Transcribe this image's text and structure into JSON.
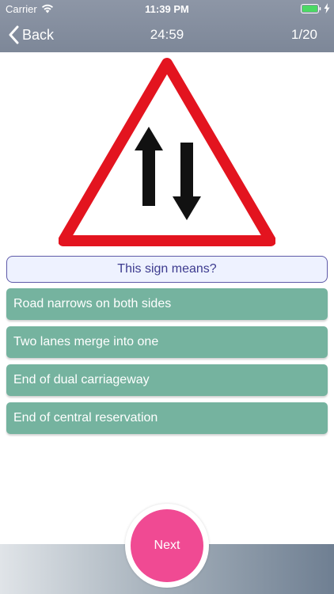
{
  "status_bar": {
    "carrier": "Carrier",
    "time": "11:39 PM",
    "icons": [
      "wifi-icon",
      "battery-icon",
      "charging-icon"
    ]
  },
  "nav": {
    "back_label": "Back",
    "timer": "24:59",
    "counter": "1/20"
  },
  "sign": {
    "description_icon": "two-way-traffic-sign",
    "colors": {
      "border": "#e3141f",
      "arrows": "#111111",
      "fill": "#ffffff"
    }
  },
  "question": {
    "text": "This sign means?"
  },
  "answers": [
    {
      "label": "Road narrows on both sides"
    },
    {
      "label": "Two lanes merge into one"
    },
    {
      "label": "End of dual carriageway"
    },
    {
      "label": "End of central reservation"
    }
  ],
  "footer": {
    "next_label": "Next"
  },
  "colors": {
    "header": "#8d96a6",
    "answer": "#75b39f",
    "question_border": "#5e5aa8",
    "next_button": "#f04a93"
  }
}
